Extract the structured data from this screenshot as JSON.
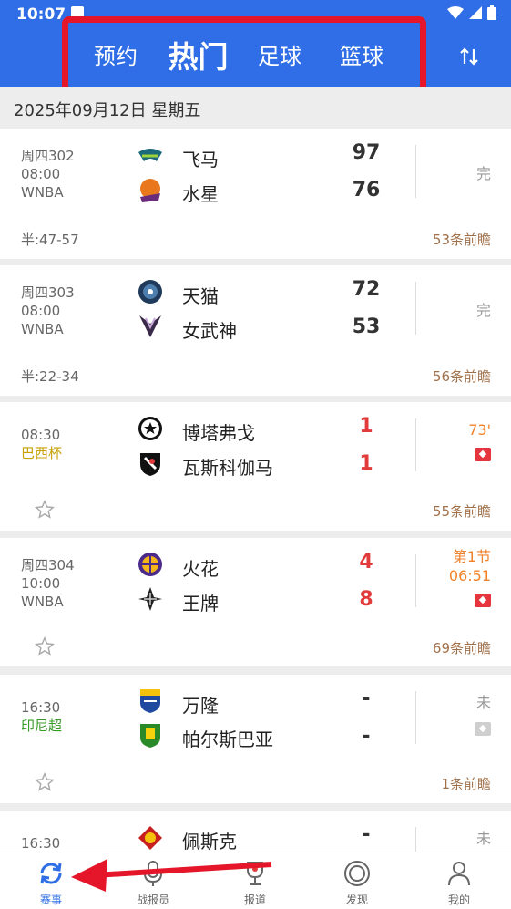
{
  "status_bar": {
    "time": "10:07"
  },
  "tabs": [
    {
      "label": "预约"
    },
    {
      "label": "热门"
    },
    {
      "label": "足球"
    },
    {
      "label": "篮球"
    }
  ],
  "date_header": "2025年09月12日  星期五",
  "matches": [
    {
      "code": "周四302",
      "time": "08:00",
      "league": "WNBA",
      "league_color": "#666666",
      "home": "飞马",
      "away": "水星",
      "home_score": "97",
      "away_score": "76",
      "status": "完",
      "half": "半:47-57",
      "comments": "53条前瞻"
    },
    {
      "code": "周四303",
      "time": "08:00",
      "league": "WNBA",
      "league_color": "#666666",
      "home": "天猫",
      "away": "女武神",
      "home_score": "72",
      "away_score": "53",
      "status": "完",
      "half": "半:22-34",
      "comments": "56条前瞻"
    },
    {
      "code": "",
      "time": "08:30",
      "league": "巴西杯",
      "league_color": "#c8a008",
      "home": "博塔弗戈",
      "away": "瓦斯科伽马",
      "home_score": "1",
      "away_score": "1",
      "status": "73'",
      "comments": "55条前瞻"
    },
    {
      "code": "周四304",
      "time": "10:00",
      "league": "WNBA",
      "league_color": "#666666",
      "home": "火花",
      "away": "王牌",
      "home_score": "4",
      "away_score": "8",
      "status_line1": "第1节",
      "status_line2": "06:51",
      "comments": "69条前瞻"
    },
    {
      "code": "",
      "time": "16:30",
      "league": "印尼超",
      "league_color": "#3a9a2a",
      "home": "万隆",
      "away": "帕尔斯巴亚",
      "home_score": "-",
      "away_score": "-",
      "status": "未",
      "comments": "1条前瞻"
    },
    {
      "code": "",
      "time": "16:30",
      "league": "",
      "home": "佩斯克",
      "home_score": "-",
      "status": "未"
    }
  ],
  "bottom_nav": [
    {
      "label": "赛事",
      "icon": "refresh-icon"
    },
    {
      "label": "战报员",
      "icon": "mic-icon"
    },
    {
      "label": "报道",
      "icon": "trophy-icon"
    },
    {
      "label": "发现",
      "icon": "discover-icon"
    },
    {
      "label": "我的",
      "icon": "user-icon"
    }
  ],
  "colors": {
    "primary": "#2f6ee6",
    "annotation_red": "#e5162a",
    "score_red": "#e23b3b",
    "live_orange": "#f0822a"
  }
}
